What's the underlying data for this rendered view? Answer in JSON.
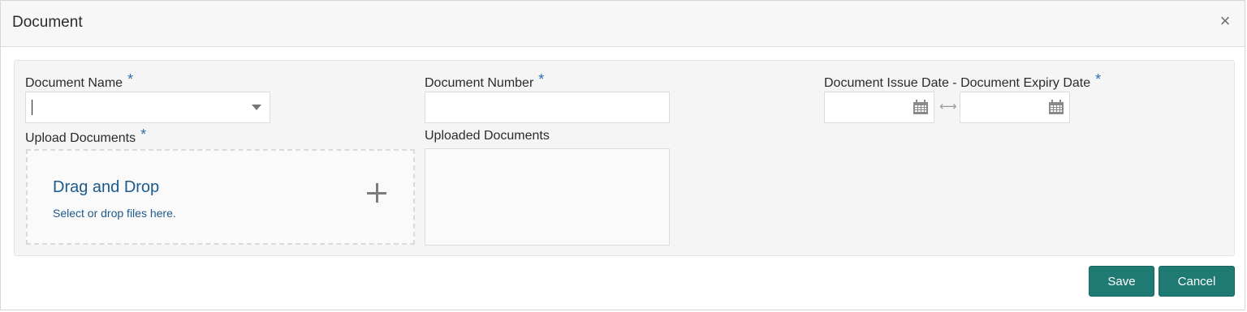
{
  "dialog": {
    "title": "Document",
    "close_glyph": "×"
  },
  "form": {
    "document_name": {
      "label": "Document Name",
      "required_mark": "*",
      "value": ""
    },
    "document_number": {
      "label": "Document Number",
      "required_mark": "*",
      "value": ""
    },
    "date_range": {
      "label": "Document Issue Date - Document Expiry Date",
      "required_mark": "*",
      "start_value": "",
      "end_value": "",
      "separator_glyph": "⟷"
    },
    "upload": {
      "label": "Upload Documents",
      "required_mark": "*",
      "dropzone_title": "Drag and Drop",
      "dropzone_subtitle": "Select or drop files here."
    },
    "uploaded": {
      "label": "Uploaded Documents"
    }
  },
  "footer": {
    "save_label": "Save",
    "cancel_label": "Cancel"
  },
  "colors": {
    "accent_button": "#1f7a74",
    "required_asterisk": "#2a6fb0",
    "dropzone_text": "#1d5a8c"
  },
  "icons": [
    "close-icon",
    "dropdown-arrow-icon",
    "calendar-icon",
    "range-arrow-icon",
    "plus-icon"
  ]
}
